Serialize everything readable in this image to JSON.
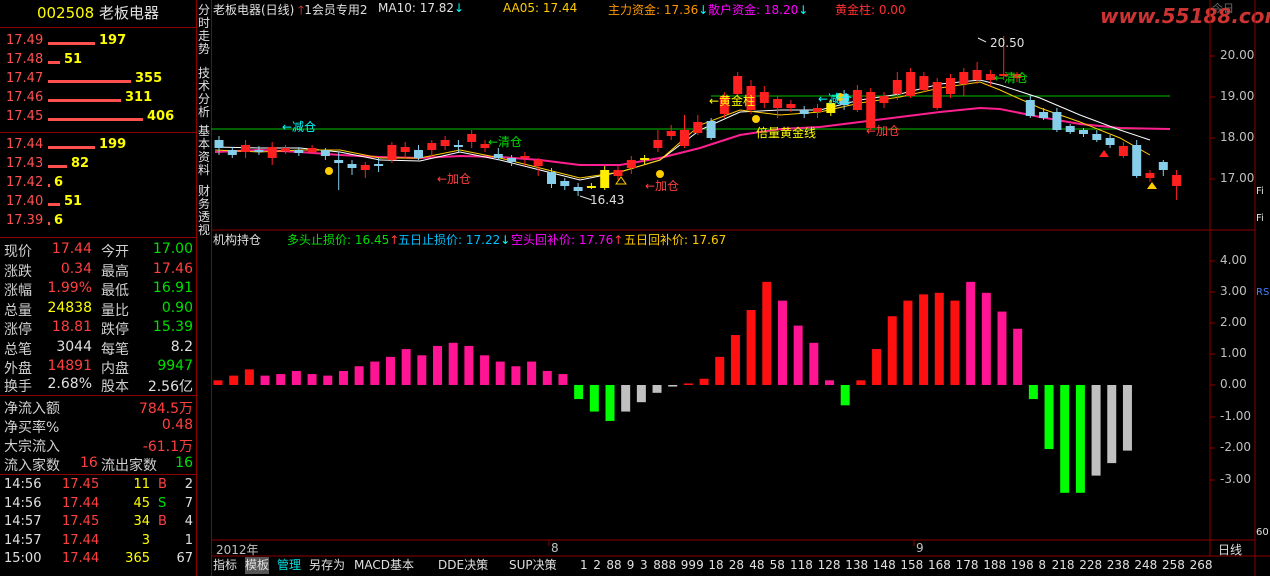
{
  "stock": {
    "code": "002508",
    "name": "老板电器"
  },
  "order_book": {
    "sells": [
      {
        "price": "17.49",
        "qty": "197",
        "ratio": 0.49
      },
      {
        "price": "17.48",
        "qty": "51",
        "ratio": 0.13
      },
      {
        "price": "17.47",
        "qty": "355",
        "ratio": 0.87
      },
      {
        "price": "17.46",
        "qty": "311",
        "ratio": 0.77
      },
      {
        "price": "17.45",
        "qty": "406",
        "ratio": 1.0
      }
    ],
    "buys": [
      {
        "price": "17.44",
        "qty": "199",
        "ratio": 0.49
      },
      {
        "price": "17.43",
        "qty": "82",
        "ratio": 0.2
      },
      {
        "price": "17.42",
        "qty": "6",
        "ratio": 0.02
      },
      {
        "price": "17.40",
        "qty": "51",
        "ratio": 0.13
      },
      {
        "price": "17.39",
        "qty": "6",
        "ratio": 0.02
      }
    ]
  },
  "quote": [
    {
      "l1": "现价",
      "v1": "17.44",
      "c1": "red",
      "l2": "今开",
      "v2": "17.00",
      "c2": "green"
    },
    {
      "l1": "涨跌",
      "v1": "0.34",
      "c1": "red",
      "l2": "最高",
      "v2": "17.46",
      "c2": "red"
    },
    {
      "l1": "涨幅",
      "v1": "1.99%",
      "c1": "red",
      "l2": "最低",
      "v2": "16.91",
      "c2": "green"
    },
    {
      "l1": "总量",
      "v1": "24838",
      "c1": "yellow",
      "l2": "量比",
      "v2": "0.90",
      "c2": "green"
    },
    {
      "l1": "涨停",
      "v1": "18.81",
      "c1": "red",
      "l2": "跌停",
      "v2": "15.39",
      "c2": "green"
    },
    {
      "l1": "总笔",
      "v1": "3044",
      "c1": "white",
      "l2": "每笔",
      "v2": "8.2",
      "c2": "white"
    },
    {
      "l1": "外盘",
      "v1": "14891",
      "c1": "red",
      "l2": "内盘",
      "v2": "9947",
      "c2": "green"
    },
    {
      "l1": "换手",
      "v1": "2.68%",
      "c1": "white",
      "l2": "股本",
      "v2": "2.56亿",
      "c2": "white"
    }
  ],
  "flow": [
    {
      "label": "净流入额",
      "value": "784.5万",
      "color": "red"
    },
    {
      "label": "净买率%",
      "value": "0.48",
      "color": "red"
    },
    {
      "label": "大宗流入",
      "value": "-61.1万",
      "color": "red"
    }
  ],
  "flow_count": {
    "in_label": "流入家数",
    "in_value": "16",
    "out_label": "流出家数",
    "out_value": "16"
  },
  "ticks": [
    {
      "time": "14:56",
      "price": "17.45",
      "vol": "11",
      "bs": "B",
      "n": "2"
    },
    {
      "time": "14:56",
      "price": "17.44",
      "vol": "45",
      "bs": "S",
      "n": "7"
    },
    {
      "time": "14:57",
      "price": "17.45",
      "vol": "34",
      "bs": "B",
      "n": "4"
    },
    {
      "time": "14:57",
      "price": "17.44",
      "vol": "3",
      "bs": "",
      "n": "1"
    },
    {
      "time": "15:00",
      "price": "17.44",
      "vol": "365",
      "bs": "",
      "n": "67"
    }
  ],
  "side_tabs": [
    "分时走势",
    "技术分析",
    "基本资料",
    "财务透视"
  ],
  "main_header": {
    "title": "老板电器(日线)",
    "member": "1会员专用2",
    "ma10": "MA10: 17.82",
    "aa05": "AA05: 17.44",
    "main_funds": "主力资金: 17.36",
    "retail_funds": "散户资金: 18.20",
    "gold_pillar": "黄金柱: 0.00"
  },
  "watermark": "www.55188.com",
  "watermark_sub": "今日",
  "price_axis": [
    "20.00",
    "19.00",
    "18.00",
    "17.00"
  ],
  "annotations": {
    "high": "20.50",
    "low": "16.43",
    "jian_cang_1": "←减仓",
    "qing_cang_1": "←清仓",
    "jia_cang_1": "←加仓",
    "jia_cang_2": "←加仓",
    "huang_jin": "←黄金柱",
    "bei_liang": "倍量黄金线",
    "jian_cang_2": "←减仓",
    "jia_cang_3": "←加仓",
    "qing_cang_2": "←清仓"
  },
  "sub_header": {
    "title": "机构持仓",
    "duo_stop": "多头止损价: 16.45",
    "five_stop": "五日止损价: 17.22",
    "kong_buy": "空头回补价: 17.76",
    "five_buy": "五日回补价: 17.67"
  },
  "sub_axis": [
    "4.00",
    "3.00",
    "2.00",
    "1.00",
    "0.00",
    "-1.00",
    "-2.00",
    "-3.00"
  ],
  "date_axis": {
    "year": "2012年",
    "m8": "8",
    "m9": "9",
    "period": "日线"
  },
  "bottom_buttons": [
    "指标",
    "模板",
    "管理",
    "另存为",
    "MACD基本",
    "DDE决策",
    "SUP决策",
    "1",
    "2",
    "88",
    "9",
    "3",
    "888",
    "999",
    "18",
    "28",
    "48",
    "58",
    "118",
    "128",
    "138",
    "148",
    "158",
    "168",
    "178",
    "188",
    "198",
    "8",
    "218",
    "228",
    "238",
    "248",
    "258",
    "268"
  ],
  "right_strip": [
    "Fi",
    "Fi",
    "RS",
    "60"
  ],
  "chart_data": {
    "type": "bar",
    "title": "机构持仓",
    "ylim": [
      -4.6,
      4.6
    ],
    "values": [
      0.15,
      0.3,
      0.5,
      0.3,
      0.35,
      0.45,
      0.35,
      0.3,
      0.45,
      0.6,
      0.75,
      0.9,
      1.15,
      0.95,
      1.25,
      1.35,
      1.25,
      0.95,
      0.75,
      0.6,
      0.75,
      0.45,
      0.35,
      -0.45,
      -0.85,
      -1.15,
      -0.85,
      -0.55,
      -0.25,
      -0.05,
      0.05,
      0.2,
      0.9,
      1.6,
      2.4,
      3.3,
      2.7,
      1.9,
      1.35,
      0.15,
      -0.65,
      0.15,
      1.15,
      2.2,
      2.7,
      2.9,
      2.95,
      2.7,
      3.3,
      2.95,
      2.35,
      1.8,
      -0.45,
      -2.05,
      -3.45,
      -3.45,
      -2.9,
      -2.5,
      -2.1
    ],
    "colors": [
      "red",
      "red",
      "red",
      "pink",
      "pink",
      "pink",
      "pink",
      "pink",
      "pink",
      "pink",
      "pink",
      "pink",
      "pink",
      "pink",
      "pink",
      "pink",
      "pink",
      "pink",
      "pink",
      "pink",
      "pink",
      "pink",
      "pink",
      "green",
      "green",
      "green",
      "grey",
      "grey",
      "grey",
      "grey",
      "red",
      "red",
      "red",
      "red",
      "red",
      "red",
      "pink",
      "pink",
      "pink",
      "pink",
      "green",
      "red",
      "red",
      "red",
      "red",
      "red",
      "red",
      "red",
      "pink",
      "pink",
      "pink",
      "pink",
      "green",
      "green",
      "green",
      "green",
      "grey",
      "grey",
      "grey"
    ]
  }
}
